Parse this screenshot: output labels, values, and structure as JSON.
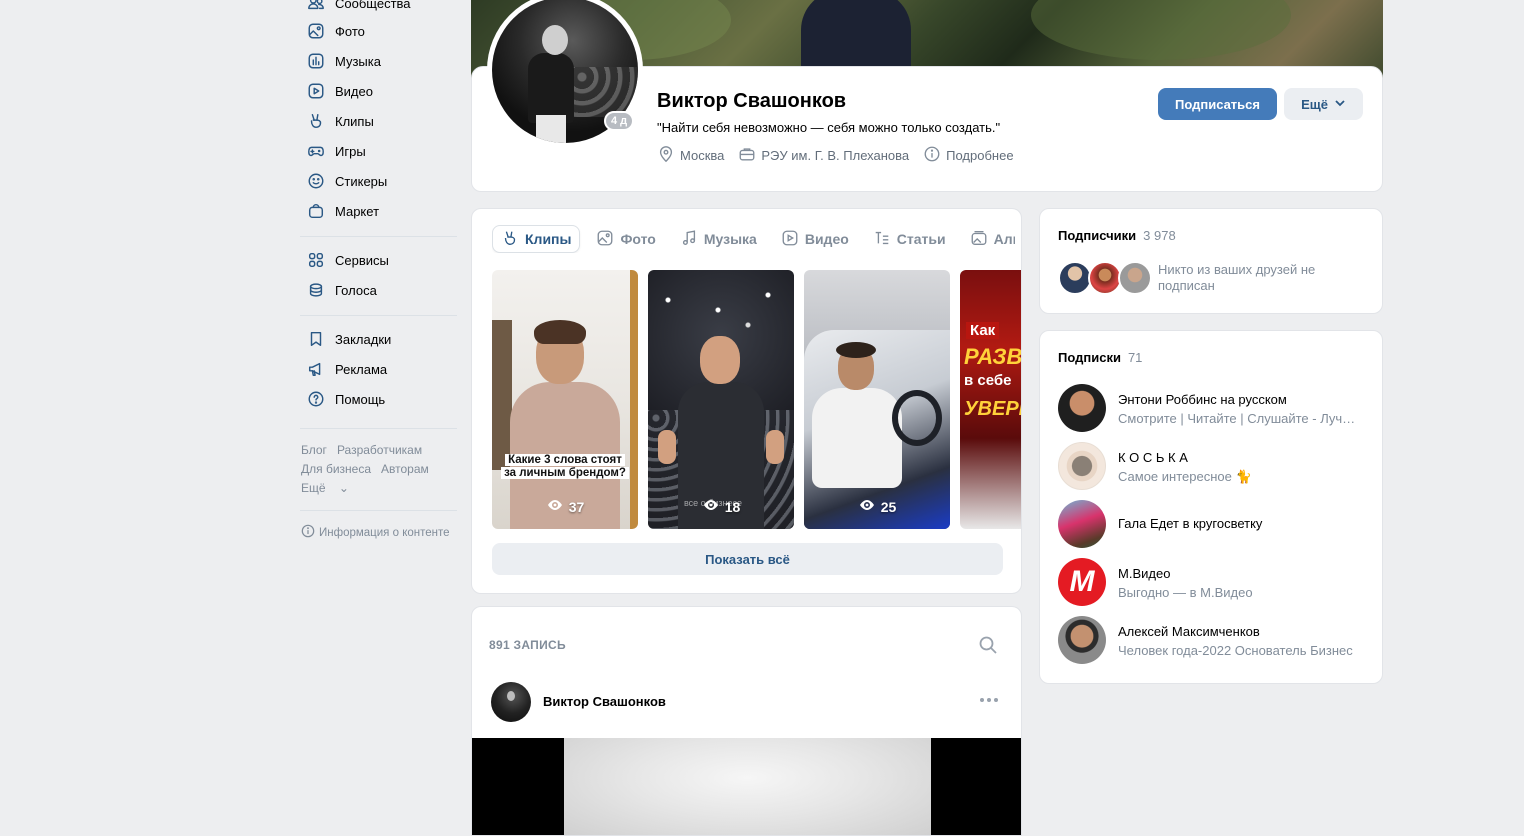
{
  "sidebar": {
    "items": [
      {
        "label": "Сообщества",
        "icon": "communities-icon"
      },
      {
        "label": "Фото",
        "icon": "photo-icon"
      },
      {
        "label": "Музыка",
        "icon": "music-icon"
      },
      {
        "label": "Видео",
        "icon": "video-icon"
      },
      {
        "label": "Клипы",
        "icon": "clips-icon"
      },
      {
        "label": "Игры",
        "icon": "gamepad-icon"
      },
      {
        "label": "Стикеры",
        "icon": "smile-icon"
      },
      {
        "label": "Маркет",
        "icon": "bag-icon"
      },
      {
        "label": "Сервисы",
        "icon": "grid-icon"
      },
      {
        "label": "Голоса",
        "icon": "coins-icon"
      },
      {
        "label": "Закладки",
        "icon": "bookmark-icon"
      },
      {
        "label": "Реклама",
        "icon": "megaphone-icon"
      },
      {
        "label": "Помощь",
        "icon": "help-icon"
      }
    ],
    "footer_links": [
      "Блог",
      "Разработчикам",
      "Для бизнеса",
      "Авторам",
      "Ещё"
    ],
    "content_info": "Информация о контенте"
  },
  "profile": {
    "name": "Виктор Свашонков",
    "status": "\"Найти себя невозможно — себя можно только создать.\"",
    "online": "4 д",
    "city": "Москва",
    "university": "РЭУ им. Г. В. Плеханова",
    "more_info": "Подробнее",
    "subscribe_button": "Подписаться",
    "more_button": "Ещё"
  },
  "media": {
    "tabs": [
      "Клипы",
      "Фото",
      "Музыка",
      "Видео",
      "Статьи",
      "Альбомы"
    ],
    "clips": [
      {
        "views": "37",
        "caption": "Какие 3 слова стоят за личным брендом?"
      },
      {
        "views": "18",
        "watermark": "все о бизнесе"
      },
      {
        "views": "25"
      },
      {
        "views": "",
        "text1": "Как",
        "text2": "РАЗВИ",
        "text3": "в себе",
        "text4": "УВЕРЕН"
      }
    ],
    "show_all": "Показать всё"
  },
  "wall": {
    "count": "891 ЗАПИСЬ",
    "post_author": "Виктор Свашонков"
  },
  "followers": {
    "title": "Подписчики",
    "count": "3 978",
    "note": "Никто из ваших друзей не подписан"
  },
  "followings": {
    "title": "Подписки",
    "count": "71",
    "items": [
      {
        "name": "Энтони Роббинс на русском",
        "desc": "Смотрите | Читайте | Слушайте - Лучшее"
      },
      {
        "name": "К О С Ь К А",
        "desc": "Самое интересное 🐈"
      },
      {
        "name": "Гала Едет в кругосветку",
        "desc": ""
      },
      {
        "name": "М.Видео",
        "desc": "Выгодно — в М.Видео"
      },
      {
        "name": "Алексей Максимченков",
        "desc": "Человек года-2022 Основатель Бизнес"
      }
    ]
  },
  "colors": {
    "accent": "#447bba",
    "link": "#2a5885",
    "muted": "#818c99",
    "background": "#edeef0"
  }
}
